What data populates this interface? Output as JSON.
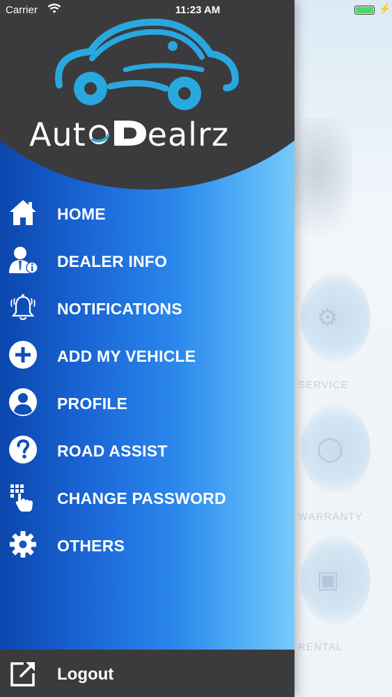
{
  "status_bar": {
    "carrier": "Carrier",
    "time": "11:23 AM",
    "battery_percent": 100
  },
  "app": {
    "logo_text_left": "Aut",
    "logo_text_right": "ealrz",
    "logo_color": "#29a8e0"
  },
  "menu": {
    "items": [
      {
        "label": "HOME",
        "icon": "home-icon"
      },
      {
        "label": "DEALER INFO",
        "icon": "dealer-info-icon"
      },
      {
        "label": "NOTIFICATIONS",
        "icon": "bell-icon"
      },
      {
        "label": "ADD MY VEHICLE",
        "icon": "plus-circle-icon"
      },
      {
        "label": "PROFILE",
        "icon": "profile-icon"
      },
      {
        "label": "ROAD ASSIST",
        "icon": "question-icon"
      },
      {
        "label": "CHANGE PASSWORD",
        "icon": "keypad-touch-icon"
      },
      {
        "label": "OTHERS",
        "icon": "gear-icon"
      }
    ]
  },
  "logout": {
    "label": "Logout",
    "icon": "external-link-icon"
  },
  "background": {
    "labels": [
      "SERVICE",
      "WARRANTY",
      "RENTAL"
    ]
  },
  "colors": {
    "drawer_dark": "#3b3b3d",
    "drawer_blue_start": "#0b46ad",
    "drawer_blue_end": "#78cafb"
  }
}
